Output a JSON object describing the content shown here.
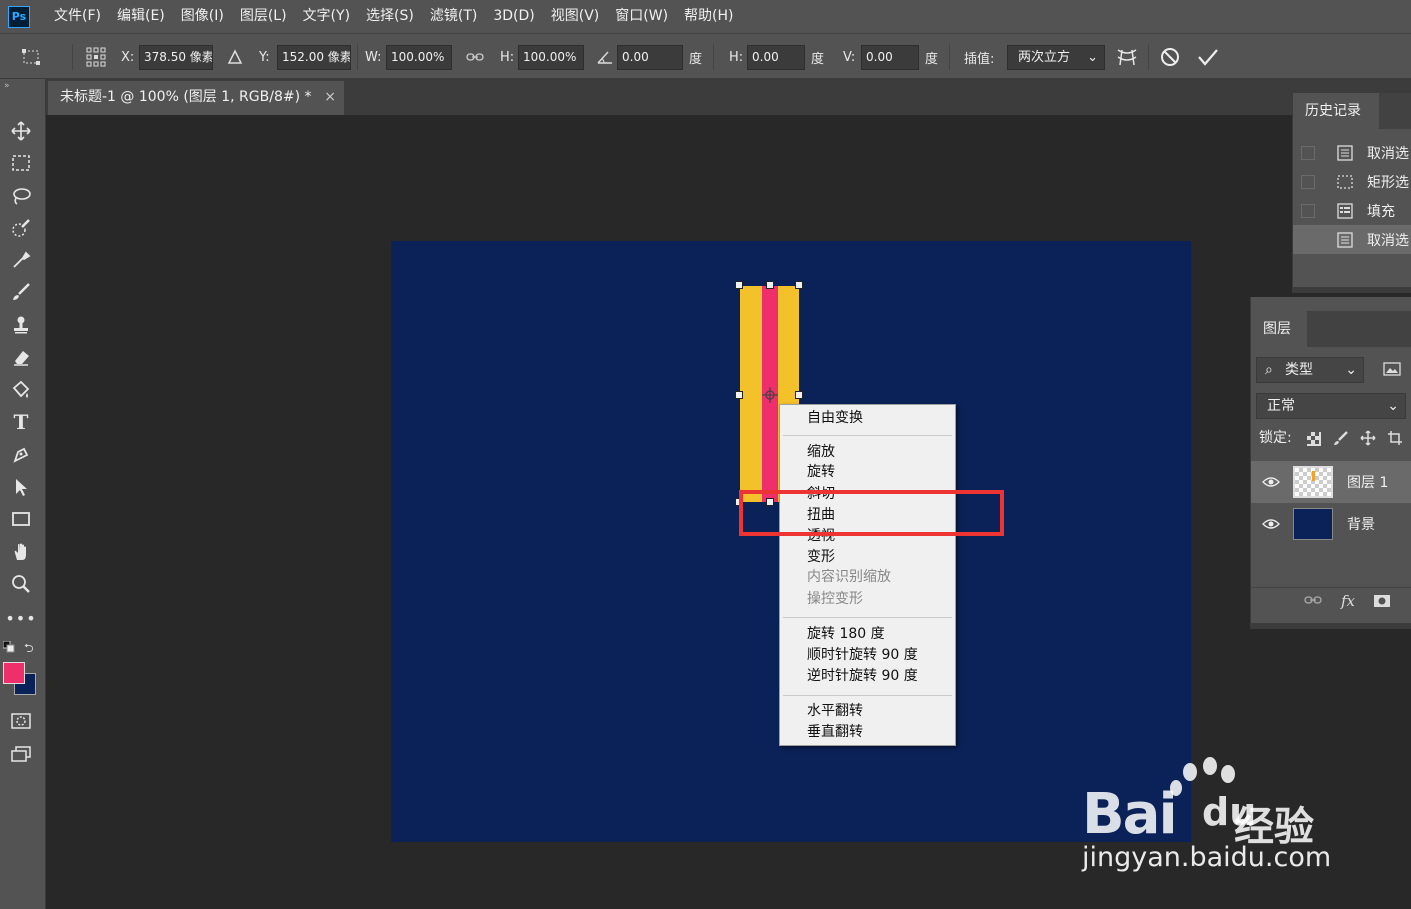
{
  "app": {
    "logo": "Ps",
    "menu": [
      "文件(F)",
      "编辑(E)",
      "图像(I)",
      "图层(L)",
      "文字(Y)",
      "选择(S)",
      "滤镜(T)",
      "3D(D)",
      "视图(V)",
      "窗口(W)",
      "帮助(H)"
    ]
  },
  "options_bar": {
    "x_label": "X:",
    "x_value": "378.50 像素",
    "y_label": "Y:",
    "y_value": "152.00 像素",
    "w_label": "W:",
    "w_value": "100.00%",
    "h_label": "H:",
    "h_value": "100.00%",
    "angle_value": "0.00",
    "angle_unit": "度",
    "skew_h_label": "H:",
    "skew_h_value": "0.00",
    "skew_h_unit": "度",
    "skew_v_label": "V:",
    "skew_v_value": "0.00",
    "skew_v_unit": "度",
    "interp_label": "插值:",
    "interp_value": "两次立方"
  },
  "document_tab": {
    "title": "未标题-1 @ 100% (图层 1, RGB/8#) *",
    "close": "×"
  },
  "colors": {
    "foreground": "#ee2f6c",
    "background": "#0b2259",
    "canvas": "#0b2259",
    "bar_yellow": "#f3c22a",
    "bar_pink": "#ee2f6c",
    "highlight": "#ee3333"
  },
  "context_menu": {
    "items": [
      {
        "label": "自由变换",
        "enabled": true
      },
      {
        "label": "缩放",
        "enabled": true
      },
      {
        "label": "旋转",
        "enabled": true
      },
      {
        "label": "斜切",
        "enabled": true
      },
      {
        "label": "扭曲",
        "enabled": true
      },
      {
        "label": "透视",
        "enabled": true
      },
      {
        "label": "变形",
        "enabled": true
      },
      {
        "label": "内容识别缩放",
        "enabled": false
      },
      {
        "label": "操控变形",
        "enabled": false
      },
      {
        "label": "旋转 180 度",
        "enabled": true
      },
      {
        "label": "顺时针旋转 90 度",
        "enabled": true
      },
      {
        "label": "逆时针旋转 90 度",
        "enabled": true
      },
      {
        "label": "水平翻转",
        "enabled": true
      },
      {
        "label": "垂直翻转",
        "enabled": true
      }
    ]
  },
  "history_panel": {
    "title": "历史记录",
    "items": [
      {
        "label": "取消选",
        "icon": "document-icon"
      },
      {
        "label": "矩形选",
        "icon": "marquee-icon"
      },
      {
        "label": "填充",
        "icon": "fill-step-icon"
      },
      {
        "label": "取消选",
        "icon": "document-icon"
      }
    ]
  },
  "layers_panel": {
    "title": "图层",
    "filter_label": "类型",
    "blend_mode": "正常",
    "lock_label": "锁定:",
    "layers": [
      {
        "name": "图层 1",
        "selected": true
      },
      {
        "name": "背景",
        "selected": false
      }
    ],
    "footer_fx": "fx"
  },
  "watermark": {
    "brand": "Bai",
    "du": "du",
    "jingyan": "经验",
    "url": "jingyan.baidu.com"
  }
}
